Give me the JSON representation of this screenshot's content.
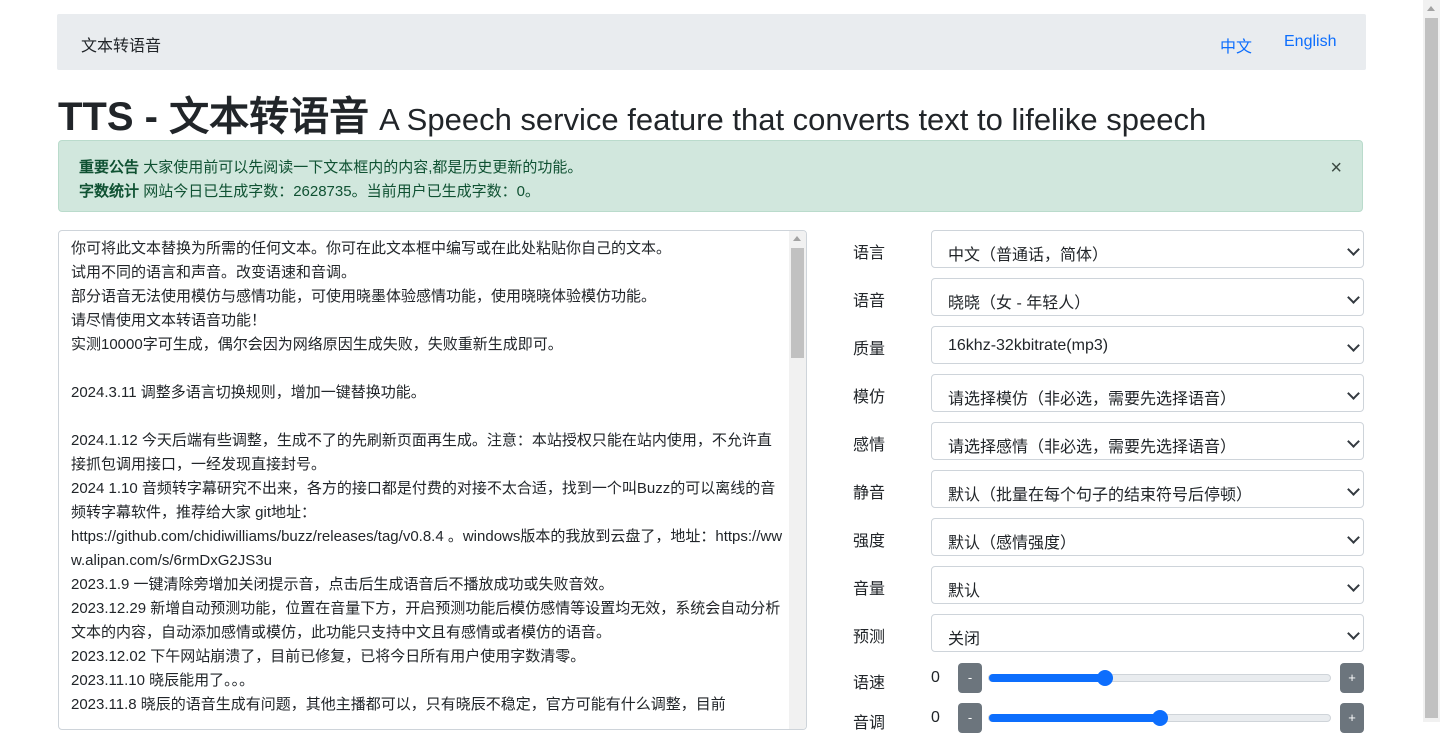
{
  "navbar": {
    "brand": "文本转语音",
    "links": [
      "中文",
      "English"
    ]
  },
  "header": {
    "title": "TTS - 文本转语音",
    "subtitle": "A Speech service feature that converts text to lifelike speech"
  },
  "alert": {
    "line1_label": "重要公告",
    "line1_text": "大家使用前可以先阅读一下文本框内的内容,都是历史更新的功能。",
    "line2_label": "字数统计",
    "line2_text": "网站今日已生成字数：2628735。当前用户已生成字数：0。",
    "close": "×"
  },
  "textarea": {
    "content": "你可将此文本替换为所需的任何文本。你可在此文本框中编写或在此处粘贴你自己的文本。\n试用不同的语言和声音。改变语速和音调。\n部分语音无法使用模仿与感情功能，可使用晓墨体验感情功能，使用晓晓体验模仿功能。\n请尽情使用文本转语音功能！\n实测10000字可生成，偶尔会因为网络原因生成失败，失败重新生成即可。\n\n2024.3.11 调整多语言切换规则，增加一键替换功能。\n\n2024.1.12 今天后端有些调整，生成不了的先刷新页面再生成。注意：本站授权只能在站内使用，不允许直接抓包调用接口，一经发现直接封号。\n2024 1.10 音频转字幕研究不出来，各方的接口都是付费的对接不太合适，找到一个叫Buzz的可以离线的音频转字幕软件，推荐给大家 git地址：\nhttps://github.com/chidiwilliams/buzz/releases/tag/v0.8.4 。windows版本的我放到云盘了，地址：https://www.alipan.com/s/6rmDxG2JS3u\n2023.1.9 一键清除旁增加关闭提示音，点击后生成语音后不播放成功或失败音效。\n2023.12.29 新增自动预测功能，位置在音量下方，开启预测功能后模仿感情等设置均无效，系统会自动分析文本的内容，自动添加感情或模仿，此功能只支持中文且有感情或者模仿的语音。\n2023.12.02 下午网站崩溃了，目前已修复，已将今日所有用户使用字数清零。\n2023.11.10 晓辰能用了。。。\n2023.11.8 晓辰的语音生成有问题，其他主播都可以，只有晓辰不稳定，官方可能有什么调整，目前"
  },
  "settings": [
    {
      "label": "语言",
      "value": "中文（普通话，简体）"
    },
    {
      "label": "语音",
      "value": "晓晓（女 - 年轻人）"
    },
    {
      "label": "质量",
      "value": "16khz-32kbitrate(mp3)"
    },
    {
      "label": "模仿",
      "value": "请选择模仿（非必选，需要先选择语音）"
    },
    {
      "label": "感情",
      "value": "请选择感情（非必选，需要先选择语音）"
    },
    {
      "label": "静音",
      "value": "默认（批量在每个句子的结束符号后停顿）"
    },
    {
      "label": "强度",
      "value": "默认（感情强度）"
    },
    {
      "label": "音量",
      "value": "默认"
    },
    {
      "label": "预测",
      "value": "关闭"
    }
  ],
  "sliders": [
    {
      "label": "语速",
      "value": "0",
      "minus": "-",
      "plus": "+",
      "level": 0.34
    },
    {
      "label": "音调",
      "value": "0",
      "minus": "-",
      "plus": "+",
      "level": 0.5
    }
  ],
  "colors": {
    "primary": "#0d6efd",
    "alert_bg": "#d1e7dd",
    "alert_text": "#0f5132",
    "navbar_bg": "#e9ecef",
    "button_secondary": "#6c757d"
  }
}
